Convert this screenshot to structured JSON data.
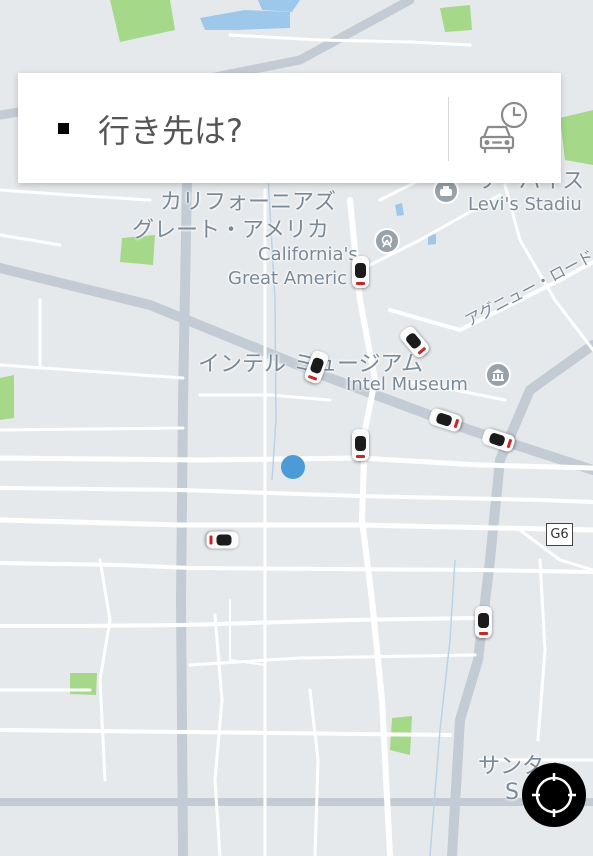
{
  "search": {
    "placeholder_text": "行き先は?"
  },
  "buttons": {
    "schedule_icon": "car-clock-icon",
    "location_icon": "crosshair-icon"
  },
  "map": {
    "labels": {
      "great_america_ja_1": "カリフォーニアズ",
      "great_america_ja_2": "グレート・アメリカ",
      "great_america_en_1": "California's",
      "great_america_en_2": "Great Americ",
      "levis_ja": "リーバイス",
      "levis_en": "Levi's Stadiu",
      "intel_ja": "インテル ミュージアム",
      "intel_en": "Intel Museum",
      "avenue_ja": "アグニュー・ロード",
      "santa_ja": "サンタ・",
      "santa_en": "S"
    },
    "route_shield": "G6"
  },
  "colors": {
    "user_location": "#4a9bd6",
    "park": "#a5d889",
    "water": "#9dc8ec",
    "road": "#ffffff",
    "highway": "#c8d1d8"
  }
}
